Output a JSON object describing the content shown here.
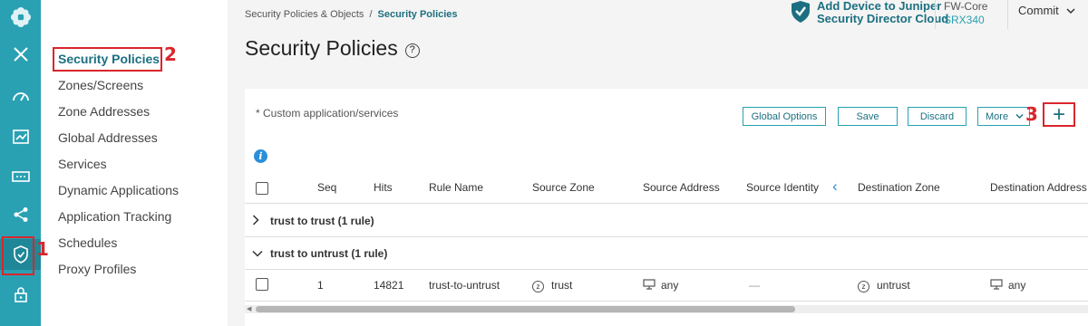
{
  "rail": {
    "icons": [
      "logo-icon",
      "close-icon",
      "dashboard-icon",
      "monitor-icon",
      "devices-icon",
      "network-icon",
      "security-shield-icon",
      "lock-icon"
    ],
    "active": "security-shield-icon"
  },
  "annotations": [
    "1",
    "2",
    "3"
  ],
  "subnav": {
    "items": [
      "Security Policies",
      "Zones/Screens",
      "Zone Addresses",
      "Global Addresses",
      "Services",
      "Dynamic Applications",
      "Application Tracking",
      "Schedules",
      "Proxy Profiles"
    ],
    "active_index": 0
  },
  "breadcrumb": {
    "parent": "Security Policies & Objects",
    "separator": "/",
    "current": "Security Policies"
  },
  "page": {
    "title": "Security Policies",
    "help": "?"
  },
  "header": {
    "juniper_line1": "Add Device to Juniper",
    "juniper_line2": "Security Director Cloud",
    "device_name": "FW-Core",
    "device_model": "SRX340",
    "commit_label": "Commit",
    "commit_icon": "chevron-down-icon"
  },
  "toolbar": {
    "note": "* Custom application/services",
    "global_options": "Global Options",
    "save": "Save",
    "discard": "Discard",
    "more": "More",
    "add": "+"
  },
  "info_icon": "i",
  "table": {
    "headers": {
      "seq": "Seq",
      "hits": "Hits",
      "rule_name": "Rule Name",
      "source_zone": "Source Zone",
      "source_address": "Source Address",
      "source_identity": "Source Identity",
      "collapse": "‹",
      "destination_zone": "Destination Zone",
      "destination_address": "Destination Address"
    },
    "groups": [
      {
        "label": "trust to trust (1 rule)",
        "expanded": false
      },
      {
        "label": "trust to untrust (1 rule)",
        "expanded": true
      }
    ],
    "rows": [
      {
        "seq": "1",
        "hits": "14821",
        "rule_name": "trust-to-untrust",
        "source_zone_icon": "z",
        "source_zone": "trust",
        "source_address": "any",
        "source_identity": "—",
        "destination_zone_icon": "z",
        "destination_zone": "untrust",
        "destination_address": "any"
      }
    ]
  },
  "colors": {
    "rail": "#2aa1b3",
    "accent": "#1b6f80",
    "annotation": "#d9262c"
  }
}
